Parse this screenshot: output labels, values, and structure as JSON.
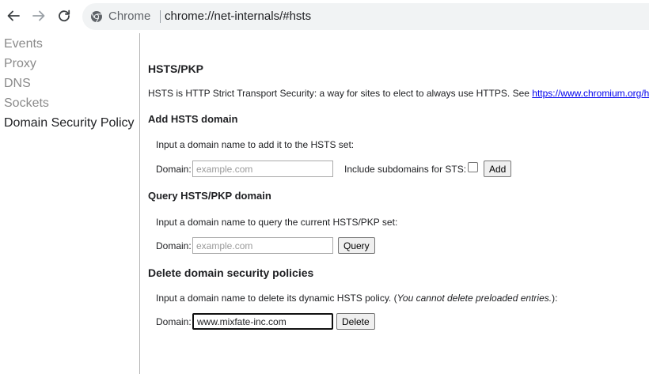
{
  "toolbar": {
    "back_icon": "back-arrow-icon",
    "forward_icon": "forward-arrow-icon",
    "reload_icon": "reload-icon",
    "site_label": "Chrome",
    "url": "chrome://net-internals/#hsts"
  },
  "sidebar": {
    "items": [
      {
        "label": "Events"
      },
      {
        "label": "Proxy"
      },
      {
        "label": "DNS"
      },
      {
        "label": "Sockets"
      },
      {
        "label": "Domain Security Policy"
      }
    ]
  },
  "main": {
    "title": "HSTS/PKP",
    "description": "HSTS is HTTP Strict Transport Security: a way for sites to elect to always use HTTPS. See",
    "link": "https://www.chromium.org/hsts.",
    "add": {
      "heading": "Add HSTS domain",
      "instruction": "Input a domain name to add it to the HSTS set:",
      "domain_label": "Domain:",
      "domain_placeholder": "example.com",
      "subdomains_label": "Include subdomains for STS:",
      "button": "Add"
    },
    "query": {
      "heading": "Query HSTS/PKP domain",
      "instruction": "Input a domain name to query the current HSTS/PKP set:",
      "domain_label": "Domain:",
      "domain_placeholder": "example.com",
      "button": "Query"
    },
    "delete": {
      "heading": "Delete domain security policies",
      "instruction_pre": "Input a domain name to delete its dynamic HSTS policy. (",
      "instruction_em": "You cannot delete preloaded entries.",
      "instruction_post": "):",
      "domain_label": "Domain:",
      "domain_value": "www.mixfate-inc.com",
      "button": "Delete"
    }
  }
}
